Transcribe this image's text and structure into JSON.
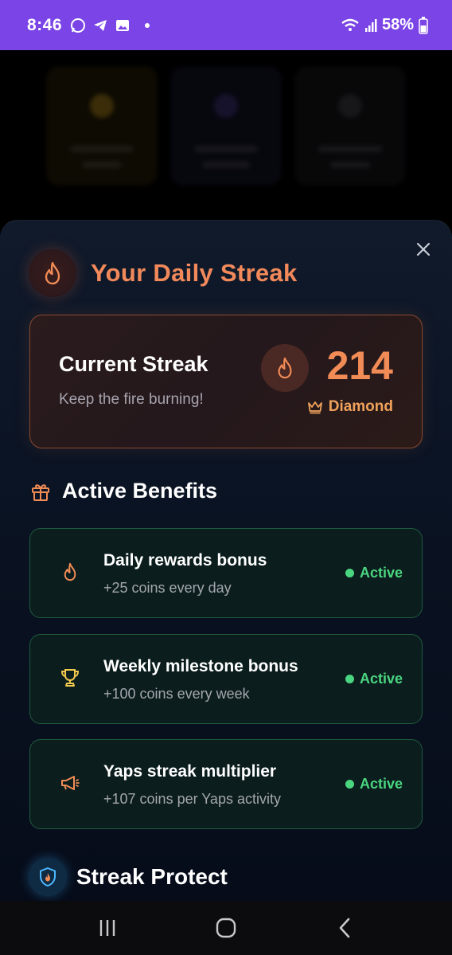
{
  "status_bar": {
    "time": "8:46",
    "battery": "58%",
    "icons": [
      "whatsapp-icon",
      "telegram-icon",
      "gallery-icon",
      "wifi-icon",
      "signal-icon",
      "battery-icon"
    ]
  },
  "sheet": {
    "title": "Your Daily Streak",
    "close_icon": "close-icon"
  },
  "streak": {
    "title": "Current Streak",
    "subtitle": "Keep the fire burning!",
    "count": "214",
    "tier": "Diamond"
  },
  "benefits": {
    "title": "Active Benefits",
    "items": [
      {
        "title": "Daily rewards bonus",
        "subtitle": "+25 coins every day",
        "status": "Active",
        "icon": "flame-icon"
      },
      {
        "title": "Weekly milestone bonus",
        "subtitle": "+100 coins every week",
        "status": "Active",
        "icon": "trophy-icon"
      },
      {
        "title": "Yaps streak multiplier",
        "subtitle": "+107 coins per Yaps activity",
        "status": "Active",
        "icon": "megaphone-icon"
      }
    ]
  },
  "protect": {
    "title": "Streak Protect"
  },
  "colors": {
    "accent_orange": "#f1895a",
    "active_green": "#4ad580",
    "status_bar": "#7b44e6"
  }
}
